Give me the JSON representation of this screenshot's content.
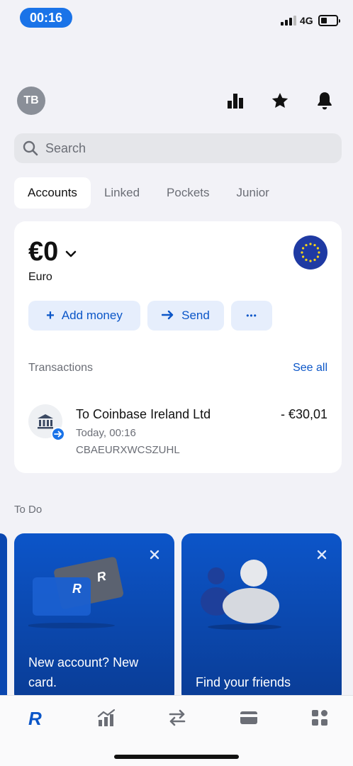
{
  "status_bar": {
    "time": "00:16",
    "network": "4G"
  },
  "header": {
    "avatar_initials": "TB"
  },
  "search": {
    "placeholder": "Search"
  },
  "tabs": [
    {
      "label": "Accounts",
      "active": true
    },
    {
      "label": "Linked",
      "active": false
    },
    {
      "label": "Pockets",
      "active": false
    },
    {
      "label": "Junior",
      "active": false
    }
  ],
  "account": {
    "balance": "€0",
    "currency_name": "Euro",
    "actions": {
      "add_money": "Add money",
      "send": "Send",
      "more": "•••"
    }
  },
  "transactions": {
    "header": "Transactions",
    "see_all": "See all",
    "items": [
      {
        "title": "To Coinbase Ireland Ltd",
        "time": "Today, 00:16",
        "reference": "CBAEURXWCSZUHL",
        "amount": "- €30,01"
      }
    ]
  },
  "todo": {
    "label": "To Do",
    "cards": [
      {
        "text_line1": "New account? New",
        "text_line2": "card."
      },
      {
        "text_line1": "Find your friends"
      }
    ]
  },
  "colors": {
    "accent": "#0b56c8",
    "promo_blue": "#0c55c9",
    "background": "#f2f2f7"
  }
}
